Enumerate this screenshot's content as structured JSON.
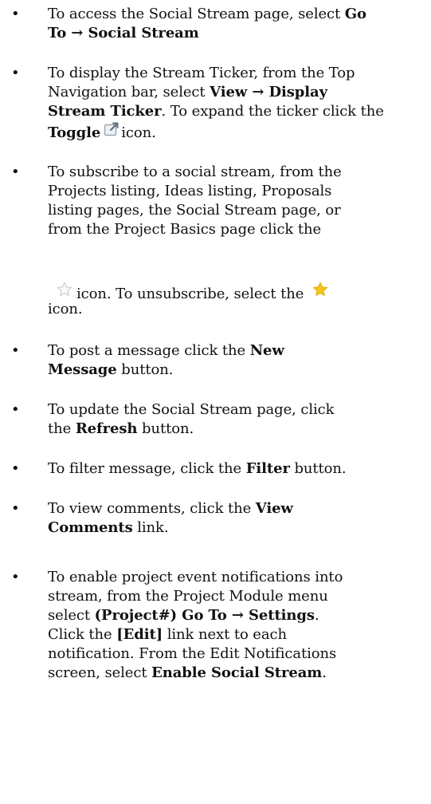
{
  "items": [
    {
      "lines": [
        [
          "To access the Social Stream page, select ",
          {
            "b": "Go"
          }
        ],
        [
          {
            "b": "To → Social Stream"
          }
        ]
      ]
    },
    {
      "lines": [
        [
          "To display the Stream Ticker, from the  Top"
        ],
        [
          "Navigation bar, select ",
          {
            "b": "View → Display"
          }
        ],
        [
          {
            "b": "Stream Ticker"
          },
          ". To expand the ticker click the"
        ],
        [
          {
            "b": "Toggle"
          },
          {
            "icon": "toggle"
          },
          "icon."
        ]
      ]
    },
    {
      "lines": [
        [
          "To subscribe to a social stream, from the"
        ],
        [
          "Projects listing, Ideas listing, Proposals"
        ],
        [
          "listing pages, the Social Stream page, or"
        ],
        [
          "from the Project Basics page click the"
        ],
        [],
        [
          {
            "icon": "star-empty"
          },
          "icon. To unsubscribe, select the ",
          {
            "icon": "star-filled"
          }
        ],
        [
          "icon."
        ]
      ]
    },
    {
      "lines": [
        [
          "To post a message click the ",
          {
            "b": "New"
          }
        ],
        [
          {
            "b": "Message"
          },
          " button."
        ]
      ]
    },
    {
      "lines": [
        [
          "To update the Social Stream page, click"
        ],
        [
          "the ",
          {
            "b": "Refresh"
          },
          " button."
        ]
      ]
    },
    {
      "lines": [
        [
          "To filter message, click the ",
          {
            "b": "Filter"
          },
          " button."
        ]
      ]
    },
    {
      "lines": [
        [
          "To view comments, click the ",
          {
            "b": "View"
          }
        ],
        [
          {
            "b": "Comments"
          },
          " link."
        ]
      ]
    },
    {
      "lines": [
        [
          "To enable project event notifications into"
        ],
        [
          "stream, from the Project Module menu"
        ],
        [
          "select ",
          {
            "b": "(Project#) Go To → Settings"
          },
          "."
        ],
        [
          "Click the ",
          {
            "b": "[Edit]"
          },
          " link next to each"
        ],
        [
          "notification. From the Edit Notifications"
        ],
        [
          "screen, select ",
          {
            "b": "Enable Social Stream"
          },
          "."
        ]
      ]
    }
  ],
  "icons": {
    "toggle": "external-link-toggle-icon",
    "star-empty": "star-outline-icon",
    "star-filled": "star-filled-icon"
  },
  "colors": {
    "text": "#111111",
    "star_fill": "#f5c518",
    "star_outline": "#c9c9c9",
    "toggle_box": "#9aa3ad"
  }
}
